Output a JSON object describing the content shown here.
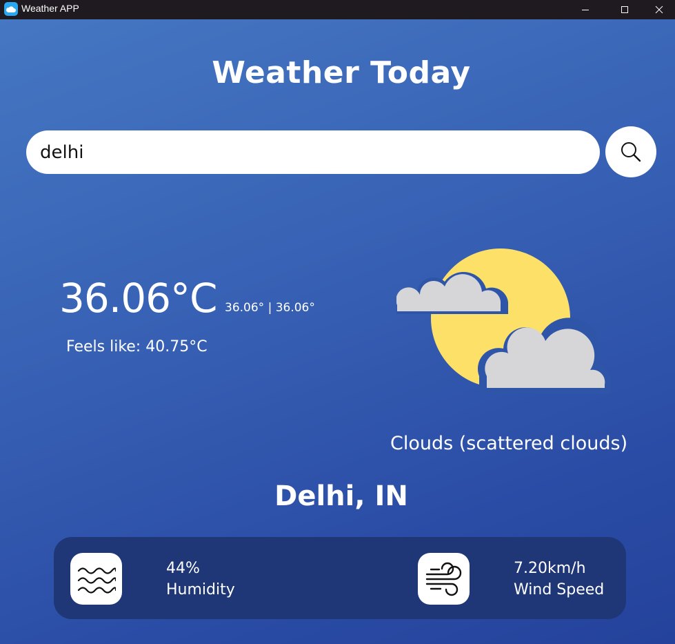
{
  "window": {
    "title": "Weather APP",
    "app_icon": "cloud-app-icon",
    "controls": [
      "minimize-icon",
      "maximize-icon",
      "close-icon"
    ]
  },
  "header": {
    "title": "Weather Today"
  },
  "search": {
    "value": "delhi",
    "placeholder": "",
    "button_icon": "search-icon"
  },
  "current": {
    "temperature": "36.06°C",
    "min_max": "36.06° | 36.06°",
    "feels_like": "Feels like: 40.75°C",
    "description": "Clouds (scattered clouds)",
    "condition_icon": "moon-with-clouds-icon"
  },
  "location": {
    "name": "Delhi, IN"
  },
  "stats": {
    "humidity": {
      "value": "44%",
      "label": "Humidity",
      "icon": "waves-icon"
    },
    "wind": {
      "value": "7.20km/h",
      "label": "Wind Speed",
      "icon": "wind-icon"
    }
  },
  "colors": {
    "background_top": "#4577c2",
    "background_bottom": "#24429b",
    "panel": "#1f3776",
    "moon": "#fde068",
    "cloud": "#d6d6d8",
    "titlebar": "#1f1a1f"
  }
}
